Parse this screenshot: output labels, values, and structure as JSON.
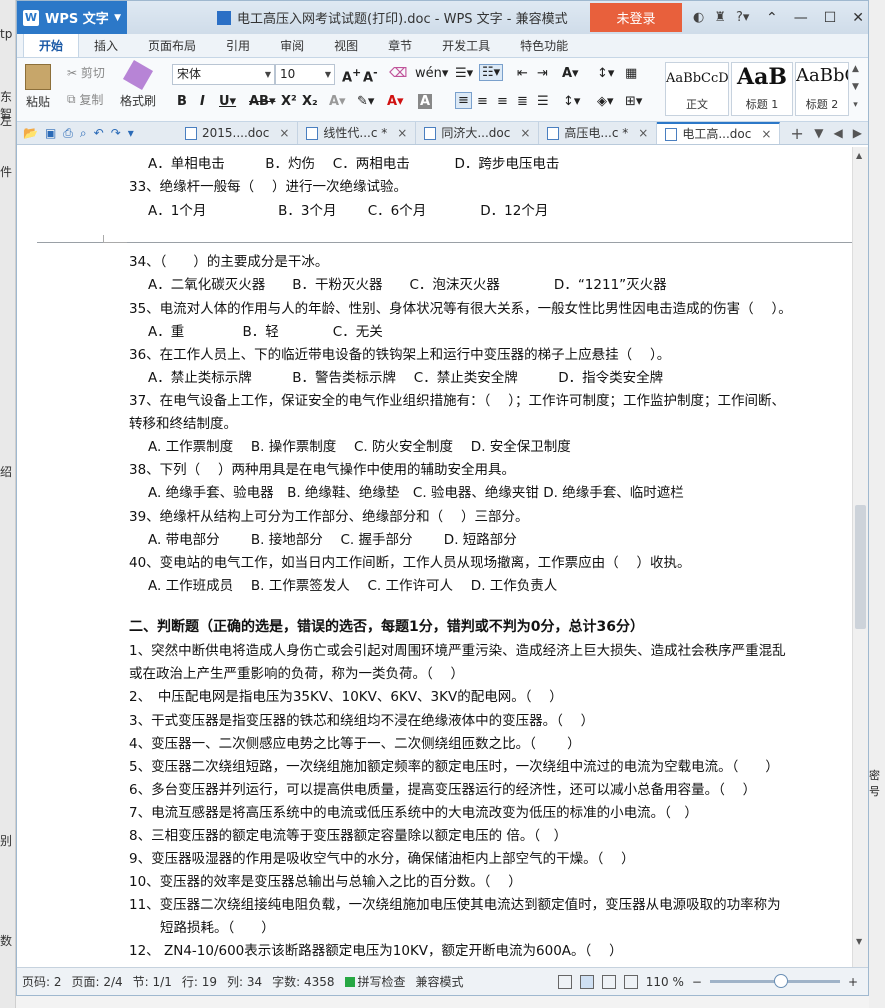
{
  "desktop": {
    "left_fragments": [
      "tp",
      "东智",
      "左",
      "件",
      "绍",
      "别",
      "数"
    ],
    "right_fragments": [
      "密号"
    ]
  },
  "titlebar": {
    "app_name": "WPS 文字",
    "doc_title": "电工高压入网考试试题(打印).doc - WPS 文字 - 兼容模式",
    "login": "未登录"
  },
  "menu": {
    "tabs": [
      "开始",
      "插入",
      "页面布局",
      "引用",
      "审阅",
      "视图",
      "章节",
      "开发工具",
      "特色功能"
    ],
    "active": 0
  },
  "ribbon": {
    "paste": "粘贴",
    "cut": "剪切",
    "copy": "复制",
    "format_painter": "格式刷",
    "font_name": "宋体",
    "font_size": "10",
    "styles": [
      {
        "preview": "AaBbCcD",
        "label": "正文"
      },
      {
        "preview": "AaB",
        "label": "标题 1"
      },
      {
        "preview": "AaBbC",
        "label": "标题 2"
      }
    ]
  },
  "doc_tabs": [
    {
      "label": "2015....doc",
      "active": false
    },
    {
      "label": "线性代...c *",
      "active": false
    },
    {
      "label": "同济大...doc",
      "active": false
    },
    {
      "label": "高压电...c *",
      "active": false
    },
    {
      "label": "电工高...doc",
      "active": true
    }
  ],
  "document": {
    "lines": [
      {
        "text": "A．单相电击　　　B．灼伤　 C．两相电击　　　 D．跨步电压电击",
        "opt": true
      },
      {
        "text": "33、绝缘杆一般每（　 ）进行一次绝缘试验。",
        "opt": false
      },
      {
        "text": "A．1个月　　　　　 B．3个月　　 C．6个月　　　　D．12个月",
        "opt": true
      },
      {
        "text": "34、（　　）的主要成分是干冰。",
        "opt": false
      },
      {
        "text": "A．二氧化碳灭火器　　B．干粉灭火器　　C．泡沫灭火器　　　　D．“1211”灭火器",
        "opt": true
      },
      {
        "text": "35、电流对人体的作用与人的年龄、性别、身体状况等有很大关系，一般女性比男性因电击造成的伤害（　 ）。",
        "opt": false
      },
      {
        "text": "A．重　　　　 B．轻　　　　C．无关",
        "opt": true
      },
      {
        "text": "36、在工作人员上、下的临近带电设备的铁钩架上和运行中变压器的梯子上应悬挂（　 ）。",
        "opt": false
      },
      {
        "text": "A．禁止类标示牌　　　B．警告类标示牌　 C．禁止类安全牌　　　D．指令类安全牌",
        "opt": true
      },
      {
        "text": "37、在电气设备上工作，保证安全的电气作业组织措施有：（　 ）；工作许可制度；工作监护制度；工作间断、",
        "opt": false
      },
      {
        "text": "转移和终结制度。",
        "opt": false
      },
      {
        "text": "A. 工作票制度　 B. 操作票制度　 C. 防火安全制度　 D. 安全保卫制度",
        "opt": true
      },
      {
        "text": "38、下列（　 ）两种用具是在电气操作中使用的辅助安全用具。",
        "opt": false
      },
      {
        "text": "A. 绝缘手套、验电器　B. 绝缘鞋、绝缘垫　C. 验电器、绝缘夹钳 D. 绝缘手套、临时遮栏",
        "opt": true
      },
      {
        "text": "39、绝缘杆从结构上可分为工作部分、绝缘部分和（　 ）三部分。",
        "opt": false
      },
      {
        "text": "A. 带电部分　　 B. 接地部分　 C. 握手部分　　 D. 短路部分",
        "opt": true
      },
      {
        "text": "40、变电站的电气工作，如当日内工作间断，工作人员从现场撤离，工作票应由（　 ）收执。",
        "opt": false
      },
      {
        "text": "A. 工作班成员　 B. 工作票签发人　 C. 工作许可人　 D. 工作负责人",
        "opt": true
      },
      {
        "text": "二、判断题（正确的选是，错误的选否，每题1分，错判或不判为0分，总计36分）",
        "opt": false
      },
      {
        "text": "1、突然中断供电将造成人身伤亡或会引起对周围环境严重污染、造成经济上巨大损失、造成社会秩序严重混乱",
        "opt": false
      },
      {
        "text": "或在政治上产生严重影响的负荷，称为一类负荷。（　 ）",
        "opt": false
      },
      {
        "text": "2、　中压配电网是指电压为35KV、10KV、6KV、3KV的配电网。（　 ）",
        "opt": false
      },
      {
        "text": "3、干式变压器是指变压器的铁芯和绕组均不浸在绝缘液体中的变压器。（　 ）",
        "opt": false
      },
      {
        "text": "4、变压器一、二次侧感应电势之比等于一、二次侧绕组匝数之比。（　　 ）",
        "opt": false
      },
      {
        "text": "5、变压器二次绕组短路，一次绕组施加额定频率的额定电压时，一次绕组中流过的电流为空载电流。（　　）",
        "opt": false
      },
      {
        "text": "6、多台变压器并列运行，可以提高供电质量，提高变压器运行的经济性，还可以减小总备用容量。（　 ）",
        "opt": false
      },
      {
        "text": "7、电流互感器是将高压系统中的电流或低压系统中的大电流改变为低压的标准的小电流。（　）",
        "opt": false
      },
      {
        "text": "8、三相变压器的额定电流等于变压器额定容量除以额定电压的 倍。（　）",
        "opt": false
      },
      {
        "text": "9、变压器吸湿器的作用是吸收空气中的水分，确保储油柜内上部空气的干燥。（　 ）",
        "opt": false
      },
      {
        "text": "10、变压器的效率是变压器总输出与总输入之比的百分数。（　 ）",
        "opt": false
      },
      {
        "text": "11、变压器二次绕组接纯电阻负载，一次绕组施加电压使其电流达到额定值时，变压器从电源吸取的功率称为",
        "opt": false
      },
      {
        "text": "短路损耗。（　　）",
        "opt": false
      },
      {
        "text": "12、 ZN4-10/600表示该断路器额定电压为10KV，额定开断电流为600A。（　 ）",
        "opt": false
      }
    ]
  },
  "status": {
    "page_code": "页码: 2",
    "page": "页面: 2/4",
    "section": "节: 1/1",
    "row": "行: 19",
    "col": "列: 34",
    "words": "字数: 4358",
    "spell": "拼写检查",
    "mode": "兼容模式",
    "zoom": "110 %",
    "zoom_level": 0.55
  }
}
